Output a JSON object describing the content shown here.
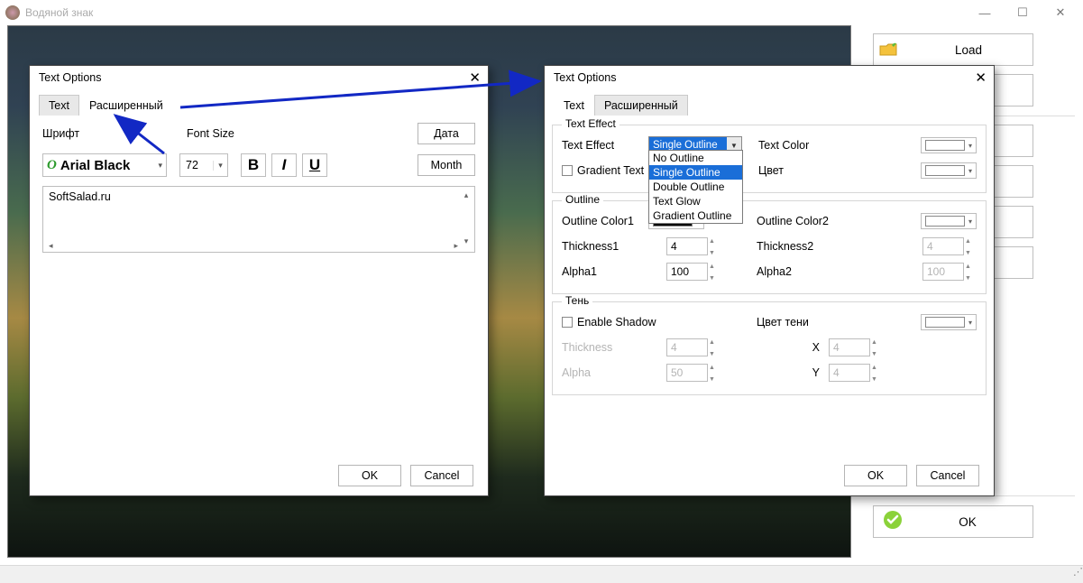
{
  "window": {
    "title": "Водяной знак"
  },
  "right": {
    "load": "Load",
    "ok": "OK"
  },
  "dlg1": {
    "title": "Text Options",
    "tab_text": "Text",
    "tab_adv": "Расширенный",
    "font_label": "Шрифт",
    "size_label": "Font Size",
    "font_name": "Arial Black",
    "font_size": "72",
    "bold": "B",
    "italic": "I",
    "underline": "U",
    "date_btn": "Дата",
    "month_btn": "Month",
    "text_value": "SoftSalad.ru",
    "ok": "OK",
    "cancel": "Cancel"
  },
  "dlg2": {
    "title": "Text Options",
    "tab_text": "Text",
    "tab_adv": "Расширенный",
    "grp_texteffect": "Text Effect",
    "lbl_texteffect": "Text Effect",
    "combo_value": "Single Outline",
    "options": [
      "No Outline",
      "Single Outline",
      "Double Outline",
      "Text Glow",
      "Gradient Outline"
    ],
    "lbl_textcolor": "Text Color",
    "chk_gradient": "Gradient Text",
    "lbl_color2": "Цвет",
    "grp_outline": "Outline",
    "lbl_oc1": "Outline Color1",
    "lbl_oc2": "Outline Color2",
    "lbl_t1": "Thickness1",
    "lbl_t2": "Thickness2",
    "val_t1": "4",
    "val_t2": "4",
    "lbl_a1": "Alpha1",
    "lbl_a2": "Alpha2",
    "val_a1": "100",
    "val_a2": "100",
    "grp_shadow": "Тень",
    "chk_shadow": "Enable Shadow",
    "lbl_shadowcolor": "Цвет тени",
    "lbl_sthick": "Thickness",
    "val_sthick": "4",
    "lbl_sx": "X",
    "val_sx": "4",
    "lbl_salpha": "Alpha",
    "val_salpha": "50",
    "lbl_sy": "Y",
    "val_sy": "4",
    "ok": "OK",
    "cancel": "Cancel"
  }
}
